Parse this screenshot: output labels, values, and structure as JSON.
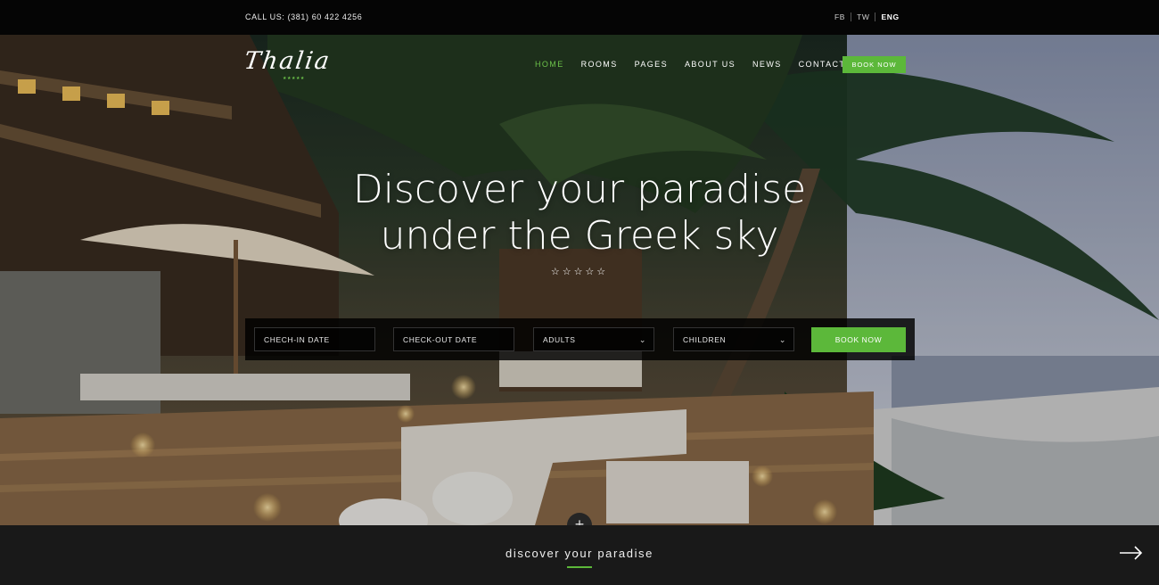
{
  "topbar": {
    "call": "CALL US: (381) 60 422 4256",
    "languages": [
      {
        "label": "FB",
        "active": false
      },
      {
        "label": "TW",
        "active": false
      },
      {
        "label": "ENG",
        "active": true
      }
    ]
  },
  "brand": {
    "logo_text": "Thalia",
    "stars": "★★★★★",
    "accent": "#5cb83a"
  },
  "nav": {
    "items": [
      {
        "label": "HOME",
        "active": true
      },
      {
        "label": "ROOMS",
        "active": false
      },
      {
        "label": "PAGES",
        "active": false
      },
      {
        "label": "ABOUT US",
        "active": false
      },
      {
        "label": "NEWS",
        "active": false
      },
      {
        "label": "CONTACT",
        "active": false
      }
    ],
    "book_label": "BOOK NOW"
  },
  "hero": {
    "line1": "Discover your paradise",
    "line2": "under the Greek sky",
    "stars": "☆☆☆☆☆"
  },
  "booking": {
    "checkin": "CHECH-IN DATE",
    "checkout": "CHECK-OUT DATE",
    "adults": "ADULTS",
    "children": "CHILDREN",
    "button": "BOOK NOW"
  },
  "strip": {
    "plus": "+",
    "tagline": "discover your paradise",
    "next_icon": "arrow-right-icon"
  }
}
